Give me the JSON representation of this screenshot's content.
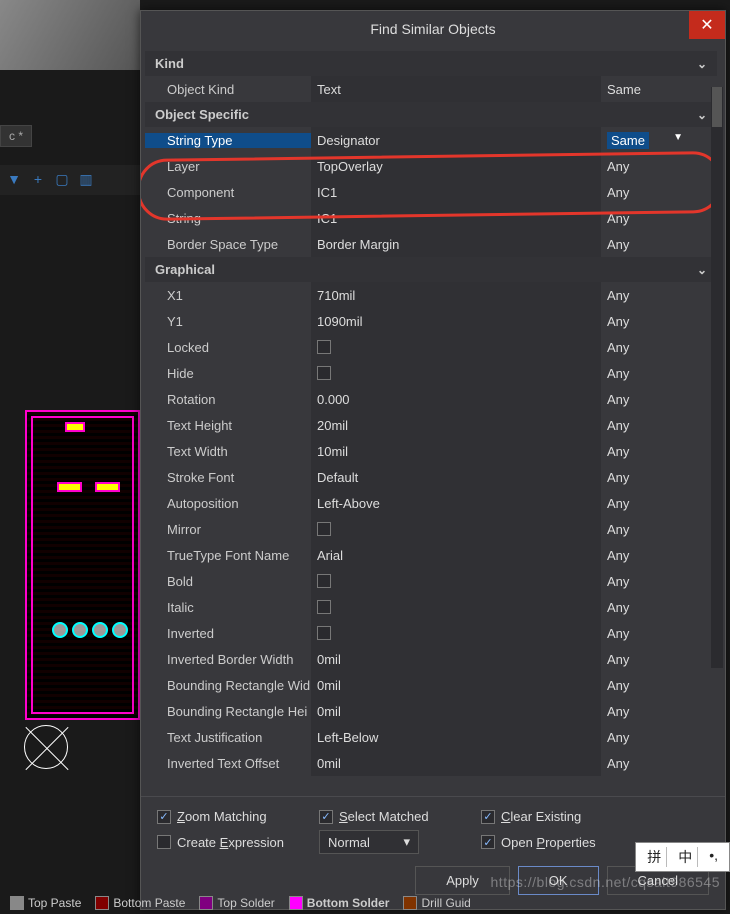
{
  "bg_tab": "c *",
  "dialog": {
    "title": "Find Similar Objects"
  },
  "sections": {
    "kind": "Kind",
    "object_specific": "Object Specific",
    "graphical": "Graphical"
  },
  "rows": {
    "kind": [
      {
        "label": "Object Kind",
        "value": "Text",
        "match": "Same"
      }
    ],
    "obj": [
      {
        "label": "String Type",
        "value": "Designator",
        "match": "Same",
        "selected": true,
        "drop": true
      },
      {
        "label": "Layer",
        "value": "TopOverlay",
        "match": "Any"
      },
      {
        "label": "Component",
        "value": "IC1",
        "match": "Any"
      },
      {
        "label": "String",
        "value": "IC1",
        "match": "Any"
      },
      {
        "label": "Border Space Type",
        "value": "Border Margin",
        "match": "Any"
      }
    ],
    "gfx": [
      {
        "label": "X1",
        "value": "710mil",
        "match": "Any"
      },
      {
        "label": "Y1",
        "value": "1090mil",
        "match": "Any"
      },
      {
        "label": "Locked",
        "value": "",
        "match": "Any",
        "check": true
      },
      {
        "label": "Hide",
        "value": "",
        "match": "Any",
        "check": true
      },
      {
        "label": "Rotation",
        "value": "0.000",
        "match": "Any"
      },
      {
        "label": "Text Height",
        "value": "20mil",
        "match": "Any"
      },
      {
        "label": "Text Width",
        "value": "10mil",
        "match": "Any"
      },
      {
        "label": "Stroke Font",
        "value": "Default",
        "match": "Any"
      },
      {
        "label": "Autoposition",
        "value": "Left-Above",
        "match": "Any"
      },
      {
        "label": "Mirror",
        "value": "",
        "match": "Any",
        "check": true
      },
      {
        "label": "TrueType Font Name",
        "value": "Arial",
        "match": "Any"
      },
      {
        "label": "Bold",
        "value": "",
        "match": "Any",
        "check": true
      },
      {
        "label": "Italic",
        "value": "",
        "match": "Any",
        "check": true
      },
      {
        "label": "Inverted",
        "value": "",
        "match": "Any",
        "check": true
      },
      {
        "label": "Inverted Border Width",
        "value": "0mil",
        "match": "Any"
      },
      {
        "label": "Bounding Rectangle Width",
        "value": "0mil",
        "match": "Any",
        "trunc": "Bounding Rectangle Wid"
      },
      {
        "label": "Bounding Rectangle Height",
        "value": "0mil",
        "match": "Any",
        "trunc": "Bounding Rectangle Hei"
      },
      {
        "label": "Text Justification",
        "value": "Left-Below",
        "match": "Any"
      },
      {
        "label": "Inverted Text Offset",
        "value": "0mil",
        "match": "Any"
      }
    ]
  },
  "footer": {
    "zoom": "Zoom Matching",
    "select": "Select Matched",
    "clear": "Clear Existing",
    "create": "Create Expression",
    "normal": "Normal",
    "open": "Open Properties",
    "apply": "Apply",
    "ok": "OK",
    "cancel": "Cancel"
  },
  "layers": {
    "top_paste": "Top Paste",
    "bottom_paste": "Bottom Paste",
    "top_solder": "Top Solder",
    "bottom_solder": "Bottom Solder",
    "drill": "Drill Guid"
  },
  "ime": {
    "a": "拼",
    "b": "中",
    "c": "•,"
  },
  "watermark": "https://blog.csdn.net/cqsalt986545"
}
